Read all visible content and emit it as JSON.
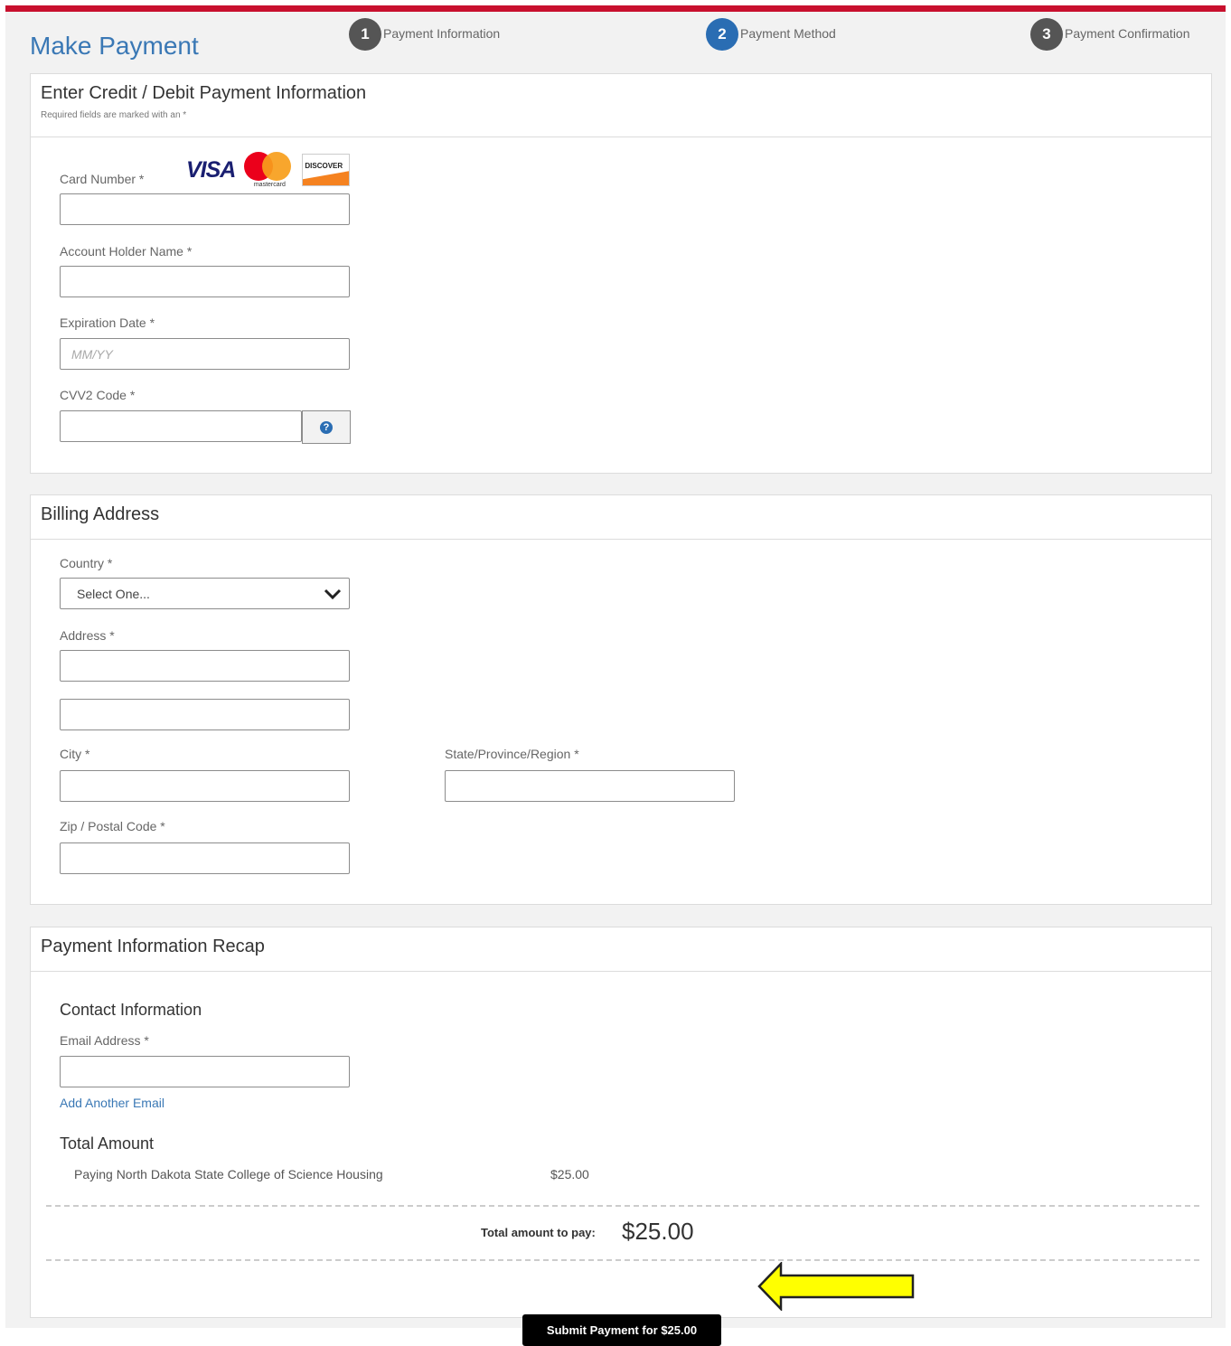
{
  "header": {
    "title": "Make Payment",
    "steps": [
      {
        "num": "1",
        "label": "Payment Information"
      },
      {
        "num": "2",
        "label": "Payment Method"
      },
      {
        "num": "3",
        "label": "Payment Confirmation"
      }
    ]
  },
  "payment_panel": {
    "title": "Enter Credit / Debit Payment Information",
    "required_note": "Required fields are marked with an *",
    "card_brands": {
      "visa": "VISA",
      "mastercard": "mastercard",
      "discover": "DISCOVER"
    },
    "card_number_label": "Card Number *",
    "holder_label": "Account Holder Name *",
    "expiration_label": "Expiration Date *",
    "expiration_placeholder": "MM/YY",
    "cvv_label": "CVV2 Code *",
    "cvv_help": "?"
  },
  "billing_panel": {
    "title": "Billing Address",
    "country_label": "Country *",
    "country_value": "Select One...",
    "address_label": "Address *",
    "city_label": "City *",
    "state_label": "State/Province/Region *",
    "zip_label": "Zip / Postal Code *"
  },
  "recap_panel": {
    "title": "Payment Information Recap",
    "contact_heading": "Contact Information",
    "email_label": "Email Address *",
    "add_email_link": "Add Another Email",
    "total_heading": "Total Amount",
    "line_description": "Paying North Dakota State College of Science Housing",
    "line_amount": "$25.00",
    "total_label": "Total amount to pay:",
    "total_value": "$25.00",
    "submit_label": "Submit Payment for $25.00"
  },
  "colors": {
    "brand_red": "#c8102e",
    "link_blue": "#3a78b5",
    "active_step": "#2a6db3",
    "annotation_arrow": "#ffff00"
  }
}
